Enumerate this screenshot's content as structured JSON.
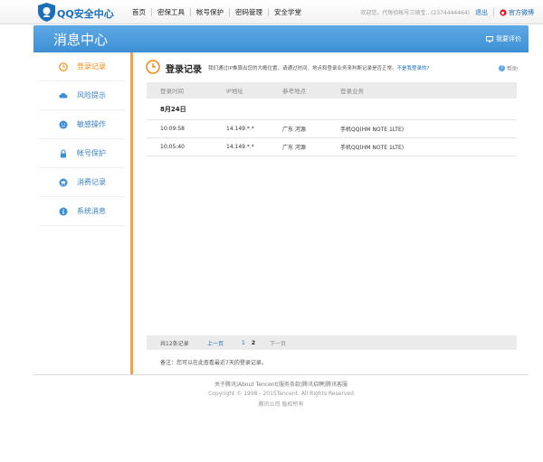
{
  "header": {
    "logo_text": "QQ安全中心",
    "nav": [
      "首页",
      "密保工具",
      "帐号保护",
      "密码管理",
      "安全学堂"
    ],
    "welcome": "欢迎您，代每侦帐号三硕宝...(2374444464)",
    "logout": "退出",
    "weibo": "官方微博"
  },
  "banner": {
    "title": "消息中心",
    "feedback": "我要评价"
  },
  "sidebar": {
    "items": [
      {
        "label": "登录记录",
        "icon": "clock-icon",
        "active": true
      },
      {
        "label": "风险提示",
        "icon": "cloud-icon",
        "active": false
      },
      {
        "label": "敏感操作",
        "icon": "face-icon",
        "active": false
      },
      {
        "label": "帐号保护",
        "icon": "lock-icon",
        "active": false
      },
      {
        "label": "消费记录",
        "icon": "cart-icon",
        "active": false
      },
      {
        "label": "系统消息",
        "icon": "info-icon",
        "active": false
      }
    ]
  },
  "content": {
    "title": "登录记录",
    "desc": "我们通过IP推算出您的大概位置，请通过时间、地点和登录业务来判断记录是否正常。",
    "ask": "不是我登录的?",
    "help": "帮助",
    "columns": [
      "登录时间",
      "IP地址",
      "参考地点",
      "登录业务"
    ],
    "date": "8月24日",
    "rows": [
      {
        "time": "10:09:58",
        "ip": "14.149.*.*",
        "location": "广东 河源",
        "service": "手机QQ(HM NOTE 1LTE)"
      },
      {
        "time": "10:05:40",
        "ip": "14.149.*.*",
        "location": "广东 河源",
        "service": "手机QQ(HM NOTE 1LTE)"
      }
    ],
    "pager": {
      "total": "共12条记录",
      "prev": "上一页",
      "page1": "1",
      "page2": "2",
      "next": "下一页"
    },
    "note": "备注：您可以在此查看最近7天的登录记录。"
  },
  "footer": {
    "links": [
      "关于腾讯",
      "About Tencent",
      "服务条款",
      "腾讯招聘",
      "腾讯客服"
    ],
    "copyright": "Copyright © 1998 - 2015Tencent. All Rights Reserved",
    "corp": "腾讯公司 版权所有"
  },
  "colors": {
    "brand_blue": "#3d8fd4",
    "active_orange": "#f08a16",
    "link_blue": "#1b6fb8"
  }
}
